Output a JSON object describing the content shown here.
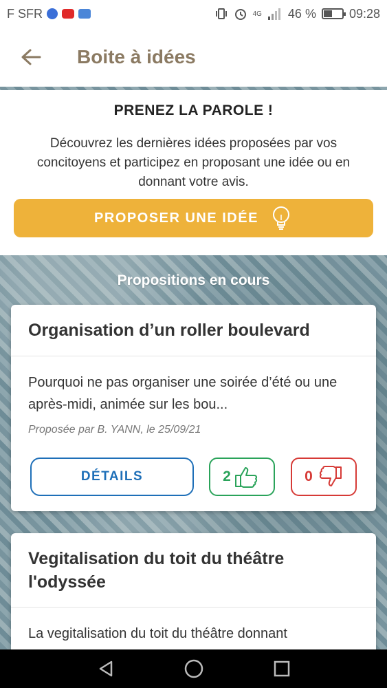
{
  "status": {
    "carrier": "F SFR",
    "network": "4G",
    "battery": "46 %",
    "battery_level": 0.46,
    "time": "09:28"
  },
  "app_bar": {
    "title": "Boite à idées"
  },
  "intro": {
    "title": "PRENEZ LA PAROLE !",
    "text": "Découvrez les dernières idées proposées par vos concitoyens et participez en proposant une idée ou en donnant votre avis.",
    "button_label": "PROPOSER UNE IDÉE"
  },
  "section_title": "Propositions en cours",
  "proposals": [
    {
      "title": "Organisation d’un roller boulevard",
      "excerpt": "Pourquoi ne pas organiser une soirée d’été ou une après-midi, animée sur les bou...",
      "meta": "Proposée par B. YANN, le 25/09/21",
      "details_label": "DÉTAILS",
      "likes": "2",
      "dislikes": "0"
    },
    {
      "title": "Vegitalisation du toit du théâtre l'odyssée",
      "excerpt": "La vegitalisation du toit du théâtre donnant"
    }
  ],
  "colors": {
    "accent": "#eeb23a",
    "title": "#8b7a62",
    "details": "#1e6fb8",
    "like": "#2aa35a",
    "dislike": "#d63a36"
  }
}
